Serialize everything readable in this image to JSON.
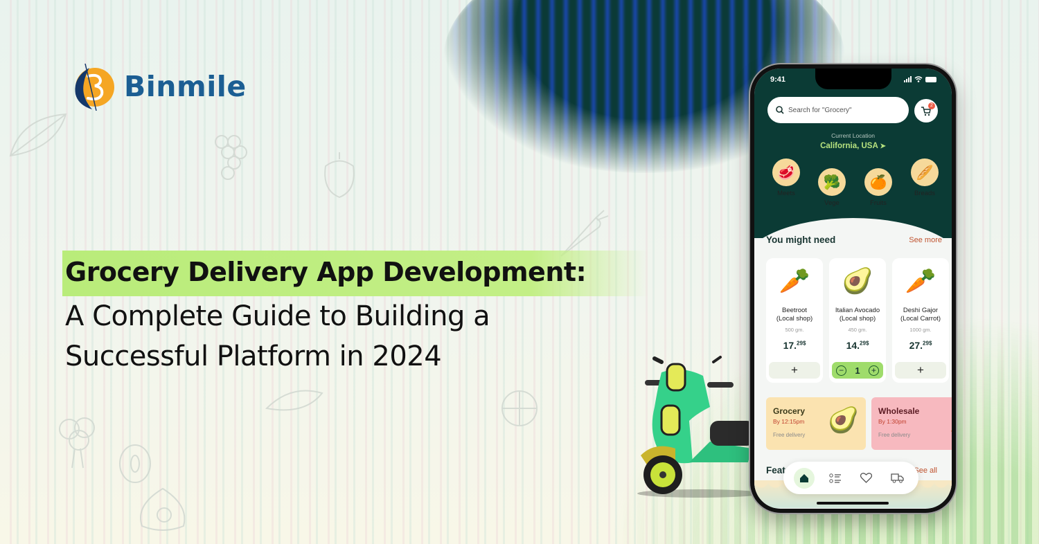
{
  "brand": {
    "name": "Binmile",
    "colors": {
      "primary": "#1b5e93",
      "accent": "#f5a623"
    }
  },
  "headline": {
    "line1": "Grocery Delivery App Development:",
    "line2": "A Complete Guide to Building a",
    "line3": "Successful Platform in 2024",
    "highlight_color": "#b9ec7a"
  },
  "phone": {
    "status": {
      "time": "9:41"
    },
    "search": {
      "placeholder": "Search for \"Grocery\""
    },
    "cart": {
      "badge_count": "2"
    },
    "location": {
      "label": "Current Location",
      "value": "California, USA"
    },
    "categories": [
      {
        "label": "Meets",
        "icon": "meat-icon"
      },
      {
        "label": "Vege",
        "icon": "broccoli-icon"
      },
      {
        "label": "Fruits",
        "icon": "fruit-icon"
      },
      {
        "label": "Breads",
        "icon": "bread-icon"
      }
    ],
    "section_needed": {
      "title": "You might need",
      "link": "See more"
    },
    "products": [
      {
        "name_line1": "Beetroot",
        "name_line2": "(Local shop)",
        "weight": "500 gm.",
        "price_main": "17.",
        "price_cents": "29$",
        "action": "+"
      },
      {
        "name_line1": "Italian Avocado",
        "name_line2": "(Local shop)",
        "weight": "450 gm.",
        "price_main": "14.",
        "price_cents": "29$",
        "quantity": "1",
        "minus": "−",
        "plus": "+"
      },
      {
        "name_line1": "Deshi Gajor",
        "name_line2": "(Local Carrot)",
        "weight": "1000 gm.",
        "price_main": "27.",
        "price_cents": "29$",
        "action": "+"
      }
    ],
    "promos": [
      {
        "title": "Grocery",
        "time": "By 12:15pm",
        "note": "Free delivery",
        "bg": "#fbe3b0",
        "title_color": "#3a3a1a"
      },
      {
        "title": "Wholesale",
        "time": "By 1:30pm",
        "note": "Free delivery",
        "bg": "#f7b9bf",
        "title_color": "#5a1a22"
      }
    ],
    "section_featured": {
      "title": "Feat",
      "link": "See all"
    },
    "tabbar": [
      {
        "name": "home-icon",
        "active": true
      },
      {
        "name": "list-icon",
        "active": false
      },
      {
        "name": "heart-icon",
        "active": false
      },
      {
        "name": "truck-icon",
        "active": false
      }
    ],
    "theme": {
      "header_bg": "#0b3b35",
      "location_color": "#b7e27f",
      "link_color": "#c0532f"
    }
  }
}
